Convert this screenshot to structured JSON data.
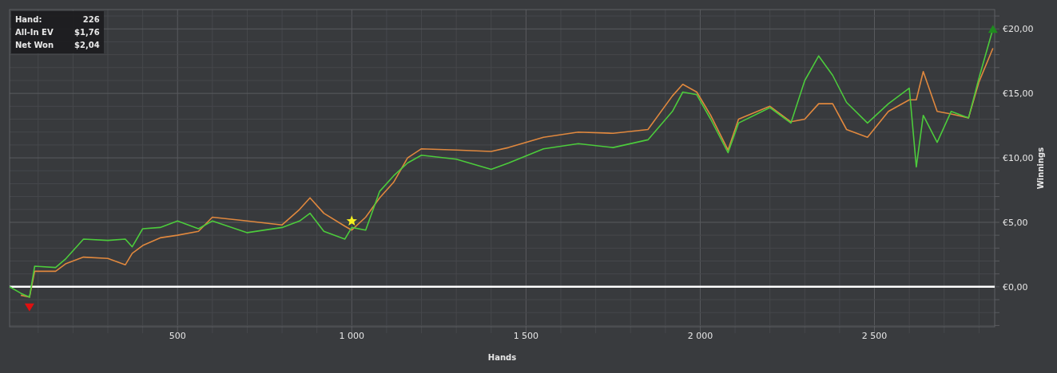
{
  "chart": {
    "hover_card": {
      "rows": [
        {
          "label": "Hand:",
          "value": "226"
        },
        {
          "label": "All-In EV",
          "value": "$1,76"
        },
        {
          "label": "Net Won",
          "value": "$2,04"
        }
      ]
    },
    "chart_data": {
      "type": "line",
      "xlabel": "Hands",
      "ylabel": "Winnings",
      "x": [
        18,
        50,
        75,
        90,
        150,
        180,
        230,
        300,
        350,
        370,
        400,
        450,
        500,
        560,
        600,
        700,
        800,
        850,
        880,
        920,
        980,
        1000,
        1040,
        1080,
        1120,
        1160,
        1200,
        1300,
        1400,
        1450,
        1550,
        1650,
        1750,
        1850,
        1920,
        1950,
        1990,
        2030,
        2080,
        2110,
        2200,
        2260,
        2300,
        2340,
        2380,
        2420,
        2480,
        2540,
        2600,
        2620,
        2640,
        2680,
        2720,
        2770,
        2800,
        2840
      ],
      "series": [
        {
          "color": "#e0883e",
          "values": [
            null,
            -0.65,
            -0.8,
            1.2,
            1.2,
            1.8,
            2.3,
            2.2,
            1.7,
            2.6,
            3.2,
            3.8,
            4.0,
            4.3,
            5.4,
            5.1,
            4.8,
            6.0,
            6.9,
            5.7,
            4.7,
            4.4,
            5.4,
            6.9,
            8.1,
            10.0,
            10.7,
            10.6,
            10.5,
            10.8,
            11.6,
            12.0,
            11.9,
            12.2,
            14.8,
            15.7,
            15.1,
            13.3,
            10.6,
            13.0,
            14.0,
            12.8,
            13.0,
            14.2,
            14.2,
            12.2,
            11.6,
            13.6,
            14.5,
            14.5,
            16.7,
            13.6,
            13.4,
            13.1,
            15.9,
            18.5
          ]
        },
        {
          "color": "#4ccb3c",
          "values": [
            0,
            -0.5,
            -0.8,
            1.6,
            1.5,
            2.2,
            3.7,
            3.6,
            3.7,
            3.1,
            4.5,
            4.6,
            5.1,
            4.5,
            5.1,
            4.2,
            4.6,
            5.1,
            5.7,
            4.3,
            3.7,
            4.6,
            4.4,
            7.4,
            8.6,
            9.6,
            10.2,
            9.9,
            9.1,
            9.6,
            10.7,
            11.1,
            10.8,
            11.4,
            13.6,
            15.1,
            14.9,
            13.0,
            10.4,
            12.7,
            13.9,
            12.7,
            16.0,
            17.9,
            16.4,
            14.3,
            12.7,
            14.2,
            15.4,
            9.3,
            13.3,
            11.2,
            13.6,
            13.1,
            16.2,
            20.0
          ]
        }
      ],
      "grid": true,
      "xlim": [
        18,
        2845
      ],
      "ylim": [
        -3.1,
        21.5
      ],
      "xticks": [
        {
          "value": 500,
          "label": "500"
        },
        {
          "value": 1000,
          "label": "1 000"
        },
        {
          "value": 1500,
          "label": "1 500"
        },
        {
          "value": 2000,
          "label": "2 000"
        },
        {
          "value": 2500,
          "label": "2 500"
        }
      ],
      "yticks": [
        {
          "value": 0,
          "label": "€0,00"
        },
        {
          "value": 5,
          "label": "€5,00"
        },
        {
          "value": 10,
          "label": "€10,00"
        },
        {
          "value": 15,
          "label": "€15,00"
        },
        {
          "value": 20,
          "label": "€20,00"
        }
      ],
      "stacked": false
    },
    "markers": [
      {
        "kind": "down-triangle",
        "color": "#e01010"
      },
      {
        "kind": "star",
        "color": "#f4f020"
      },
      {
        "kind": "up-triangle",
        "color": "#1f8a1f"
      }
    ]
  }
}
